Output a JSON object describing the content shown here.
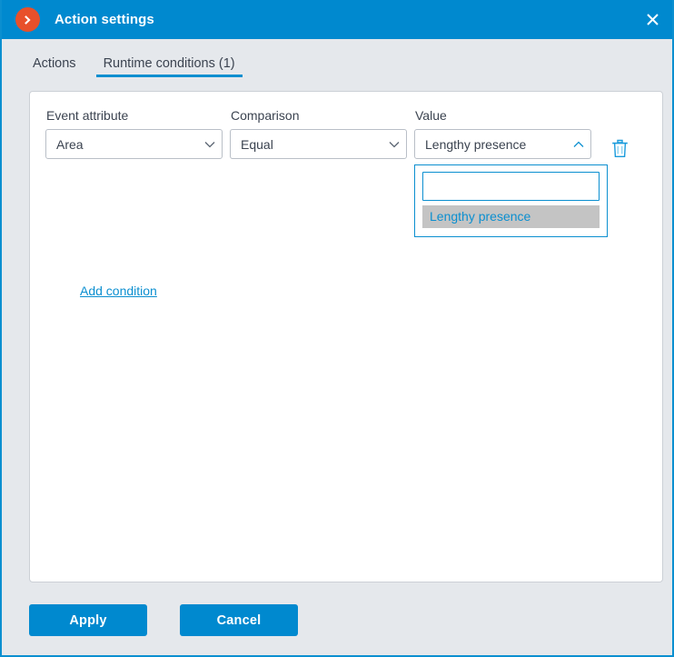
{
  "window": {
    "title": "Action settings",
    "app_icon": "chevron-right-circle-icon",
    "close_icon": "close-icon",
    "accent_color": "#0089cf",
    "icon_color": "#e8502a"
  },
  "tabs": [
    {
      "label": "Actions",
      "active": false
    },
    {
      "label": "Runtime conditions (1)",
      "active": true
    }
  ],
  "condition": {
    "attribute": {
      "label": "Event attribute",
      "value": "Area",
      "caret_icon": "chevron-down-icon"
    },
    "comparison": {
      "label": "Comparison",
      "value": "Equal",
      "caret_icon": "chevron-down-icon"
    },
    "value": {
      "label": "Value",
      "value": "Lengthy presence",
      "caret_icon": "chevron-up-icon",
      "expanded": true,
      "search_text": "",
      "search_placeholder": "",
      "options": [
        {
          "label": "Lengthy presence",
          "highlighted": true
        }
      ]
    },
    "delete_icon": "trash-icon"
  },
  "links": {
    "add_condition": "Add condition"
  },
  "footer": {
    "apply_label": "Apply",
    "cancel_label": "Cancel"
  }
}
